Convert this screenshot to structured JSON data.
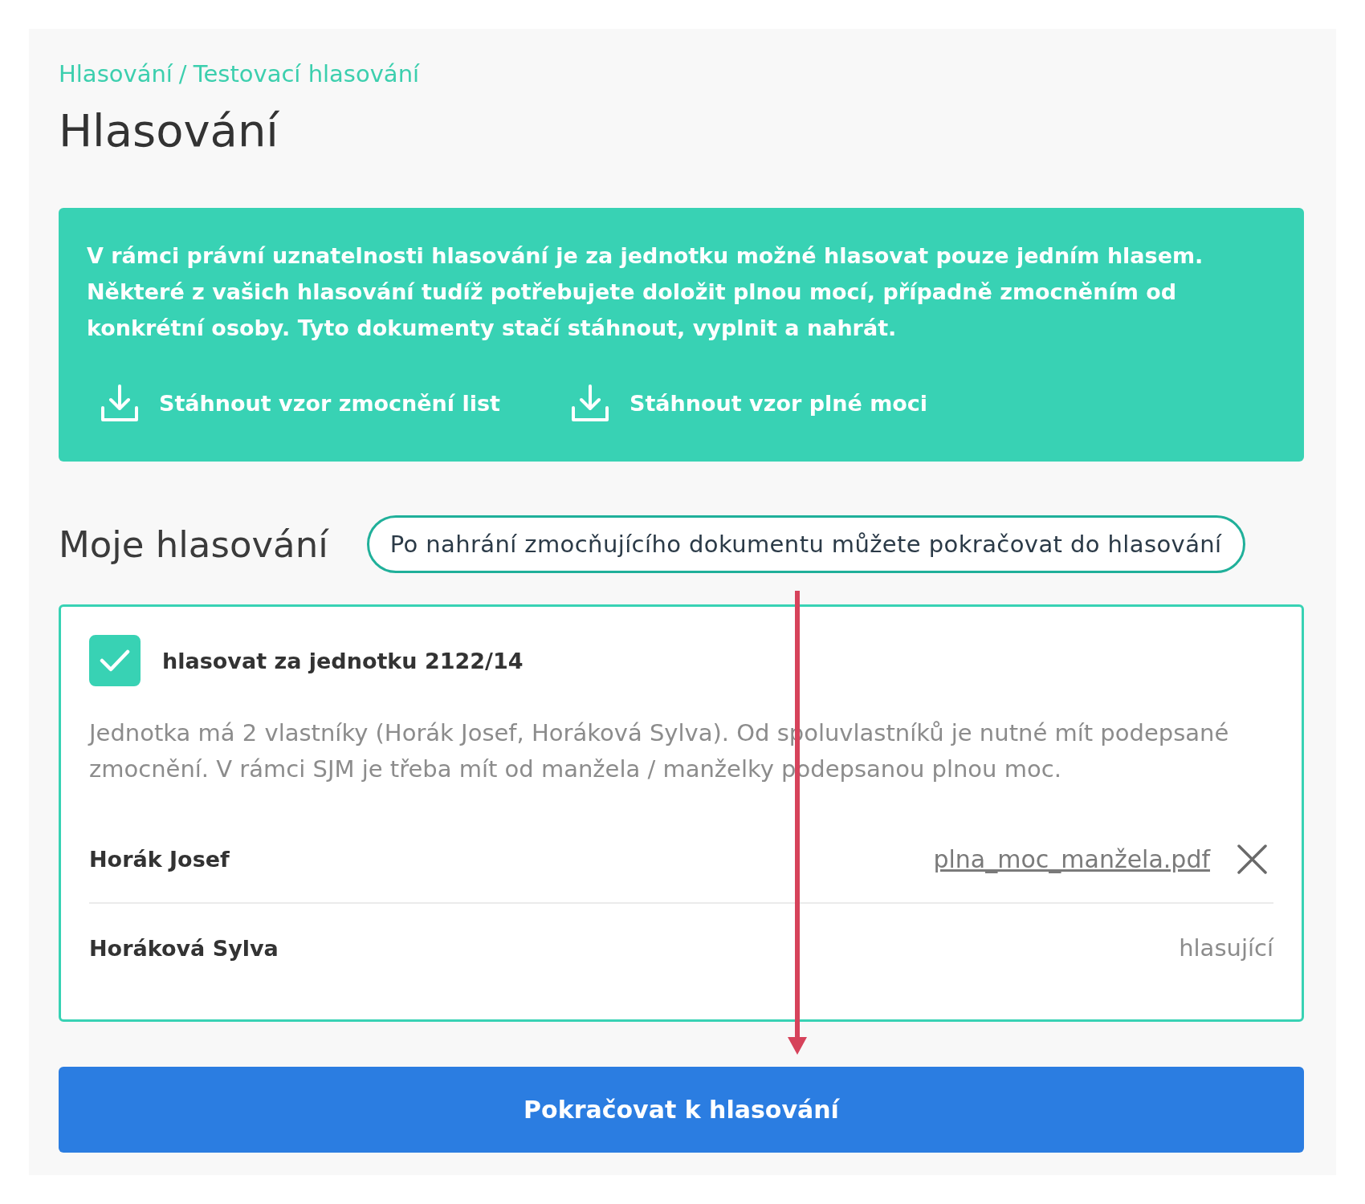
{
  "breadcrumb": {
    "items": [
      "Hlasování",
      "Testovací hlasování"
    ],
    "separator": "/"
  },
  "title": "Hlasování",
  "notice": {
    "text": "V rámci právní uznatelnosti hlasování je za jednotku možné hlasovat pouze jedním hlasem. Některé z vašich hlasování tudíž potřebujete doložit plnou mocí, případně zmocněním od konkrétní osoby. Tyto dokumenty stačí stáhnout, vyplnit a nahrát.",
    "downloads": [
      "Stáhnout vzor zmocnění list",
      "Stáhnout vzor plné moci"
    ]
  },
  "section": {
    "title": "Moje hlasování",
    "hint": "Po nahrání zmocňujícího dokumentu můžete pokračovat do hlasování"
  },
  "units": [
    {
      "label": "hlasovat za jednotku 2122/14",
      "checked": true,
      "description": "Jednotka má 2 vlastníky (Horák Josef, Horáková Sylva). Od spoluvlastníků je nutné mít podepsané zmocnění. V rámci SJM je třeba mít od manžela / manželky podepsanou plnou moc.",
      "owners": [
        {
          "name": "Horák Josef",
          "kind": "file",
          "file": "plna_moc_manžela.pdf"
        },
        {
          "name": "Horáková Sylva",
          "kind": "status",
          "status": "hlasující"
        }
      ]
    }
  ],
  "continue_button": "Pokračovat k hlasování"
}
